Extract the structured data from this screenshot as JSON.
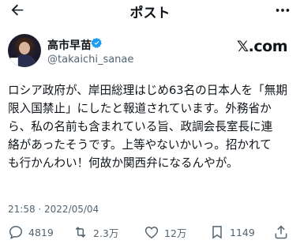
{
  "header": {
    "title": "ポスト"
  },
  "author": {
    "name": "高市早苗",
    "handle": "@takaichi_sanae"
  },
  "brand": {
    "label": "𝕏.com"
  },
  "tweet": {
    "lines": [
      "ロシア政府が、岸田総理はじめ63名の日本人を「無期",
      "限入国禁止」にしたと報道されています。外務省か",
      "ら、私の名前も含まれている旨、政調会長室長に連",
      "絡があったそうです。上等やないかいっ。招かれて",
      "も行かんわい！何故か関西弁になるんやが。"
    ]
  },
  "timestamp": "21:58 · 2022/05/04",
  "stats": {
    "replies": "4819",
    "reposts": "2.3万",
    "likes": "12万",
    "bookmarks": "1149"
  },
  "colors": {
    "verified": "#1d9bf0",
    "muted": "#536471"
  }
}
